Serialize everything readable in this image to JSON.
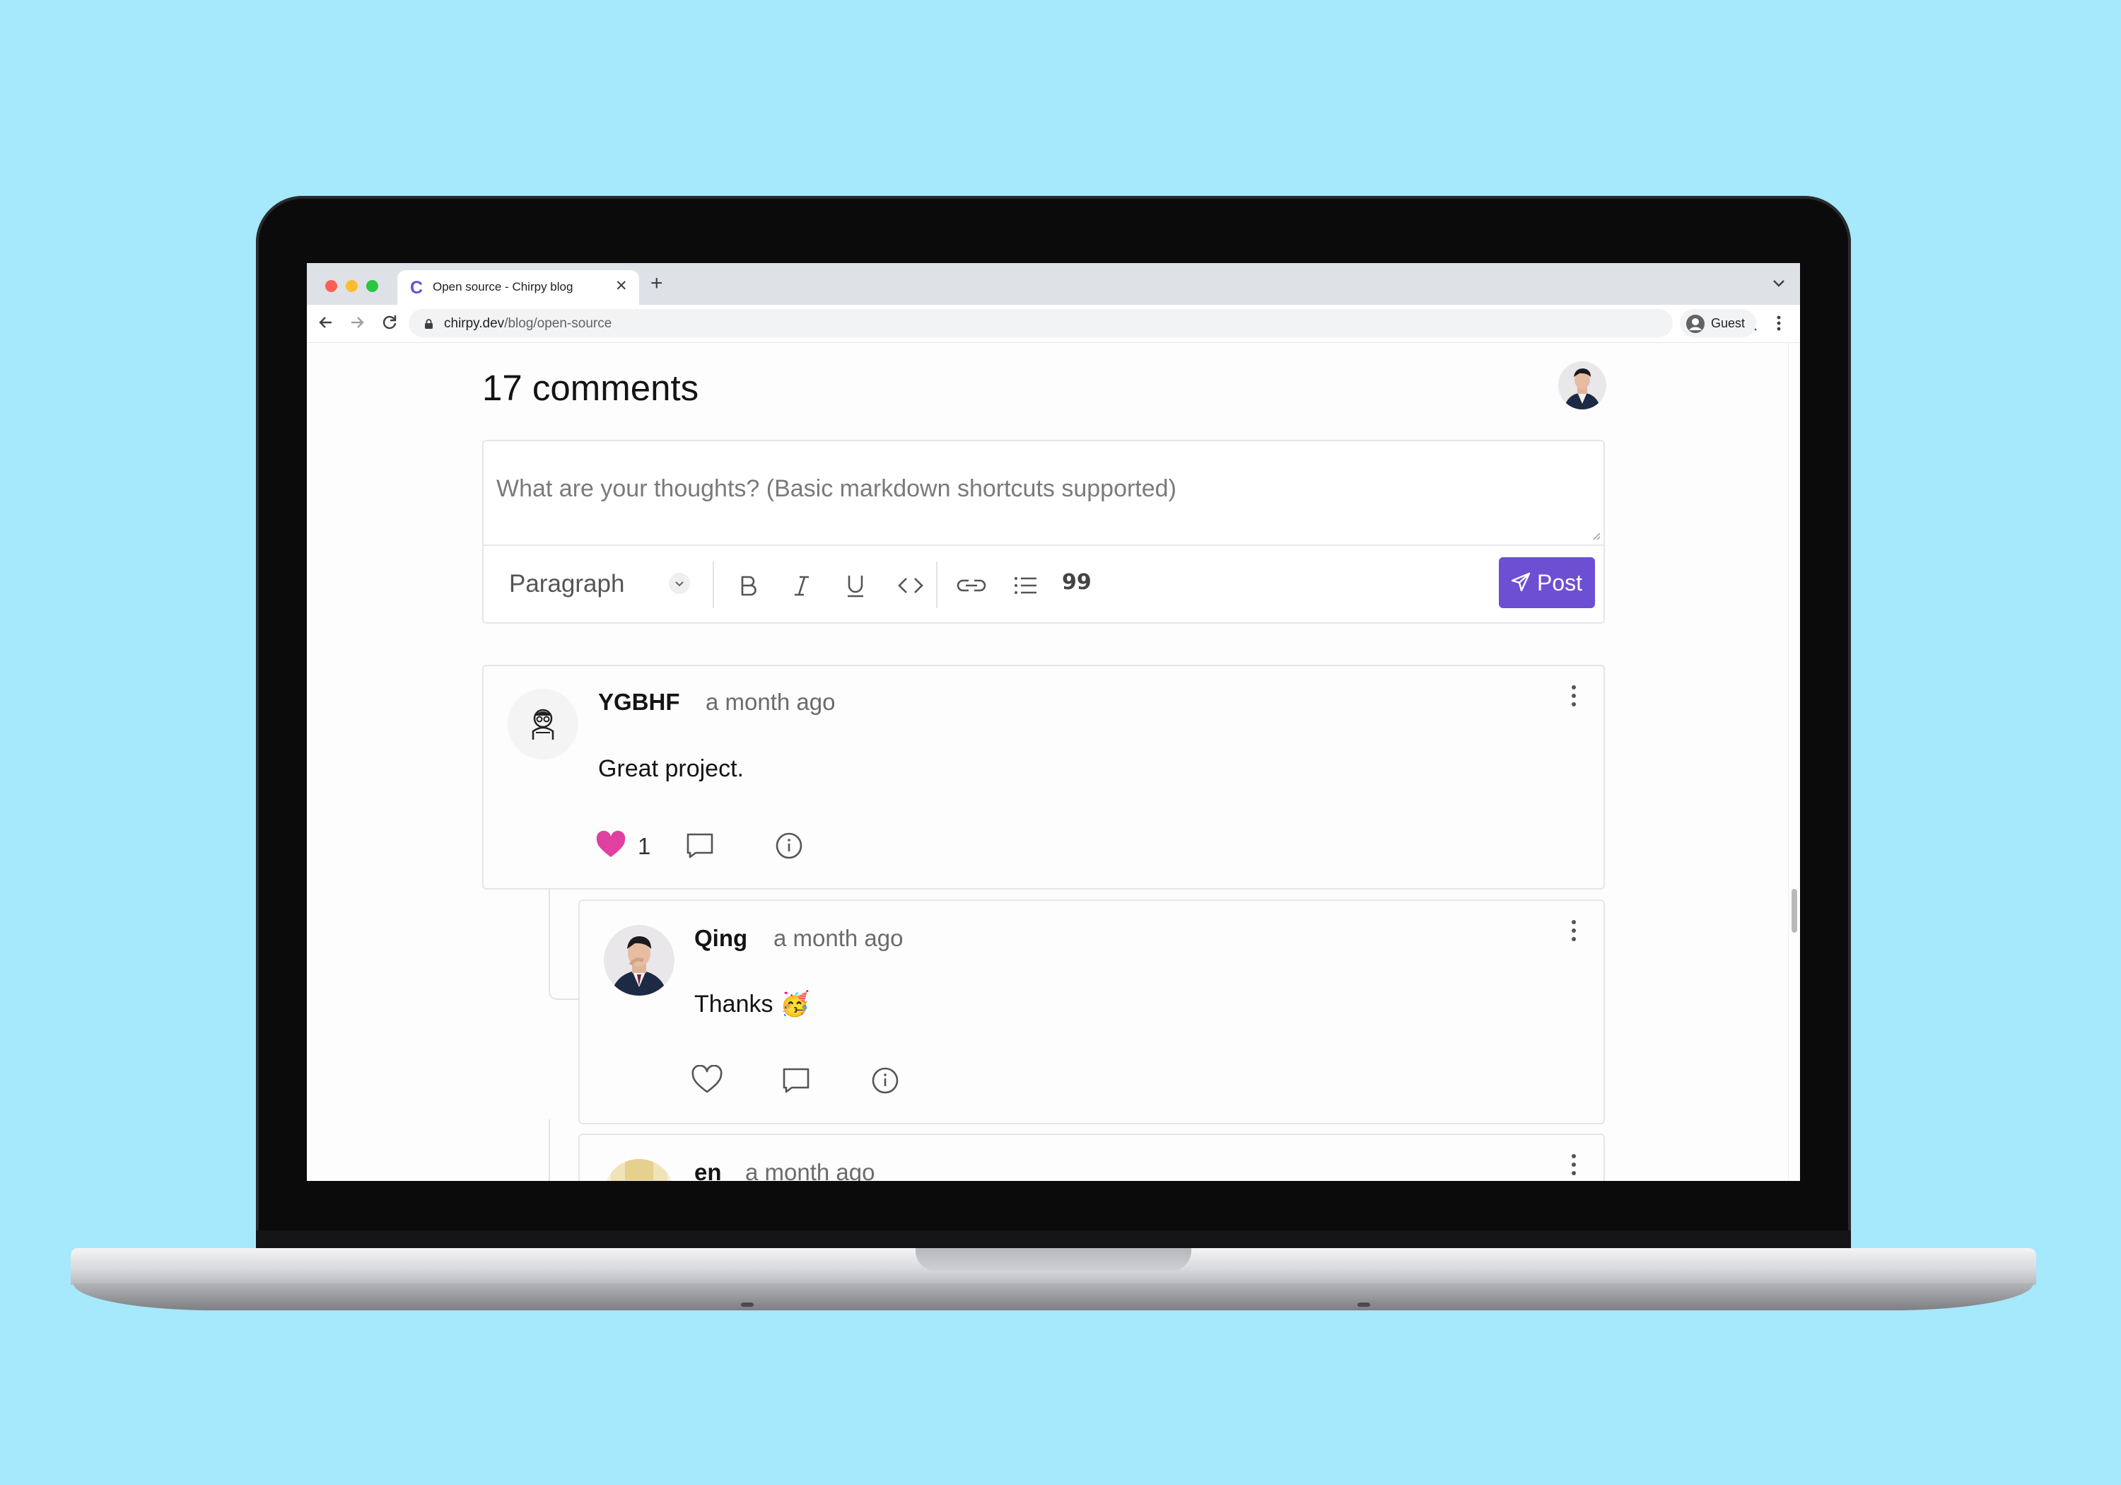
{
  "browser": {
    "tab_title": "Open source - Chirpy blog",
    "tab_favicon": "C",
    "url_host": "chirpy.dev",
    "url_path": "/blog/open-source",
    "profile_label": "Guest"
  },
  "comments_section": {
    "heading": "17 comments",
    "editor": {
      "placeholder": "What are your thoughts? (Basic markdown shortcuts supported)",
      "block_type": "Paragraph",
      "quote_label": "99",
      "post_label": "Post"
    },
    "comments": [
      {
        "author": "YGBHF",
        "time": "a month ago",
        "body": "Great project.",
        "likes": "1",
        "liked": true
      },
      {
        "author": "Qing",
        "time": "a month ago",
        "body": "Thanks 🥳",
        "liked": false
      },
      {
        "author": "en",
        "time": "a month ago"
      }
    ]
  },
  "colors": {
    "background": "#a6e8fc",
    "accent": "#6c4fd3",
    "like": "#e040a0"
  }
}
